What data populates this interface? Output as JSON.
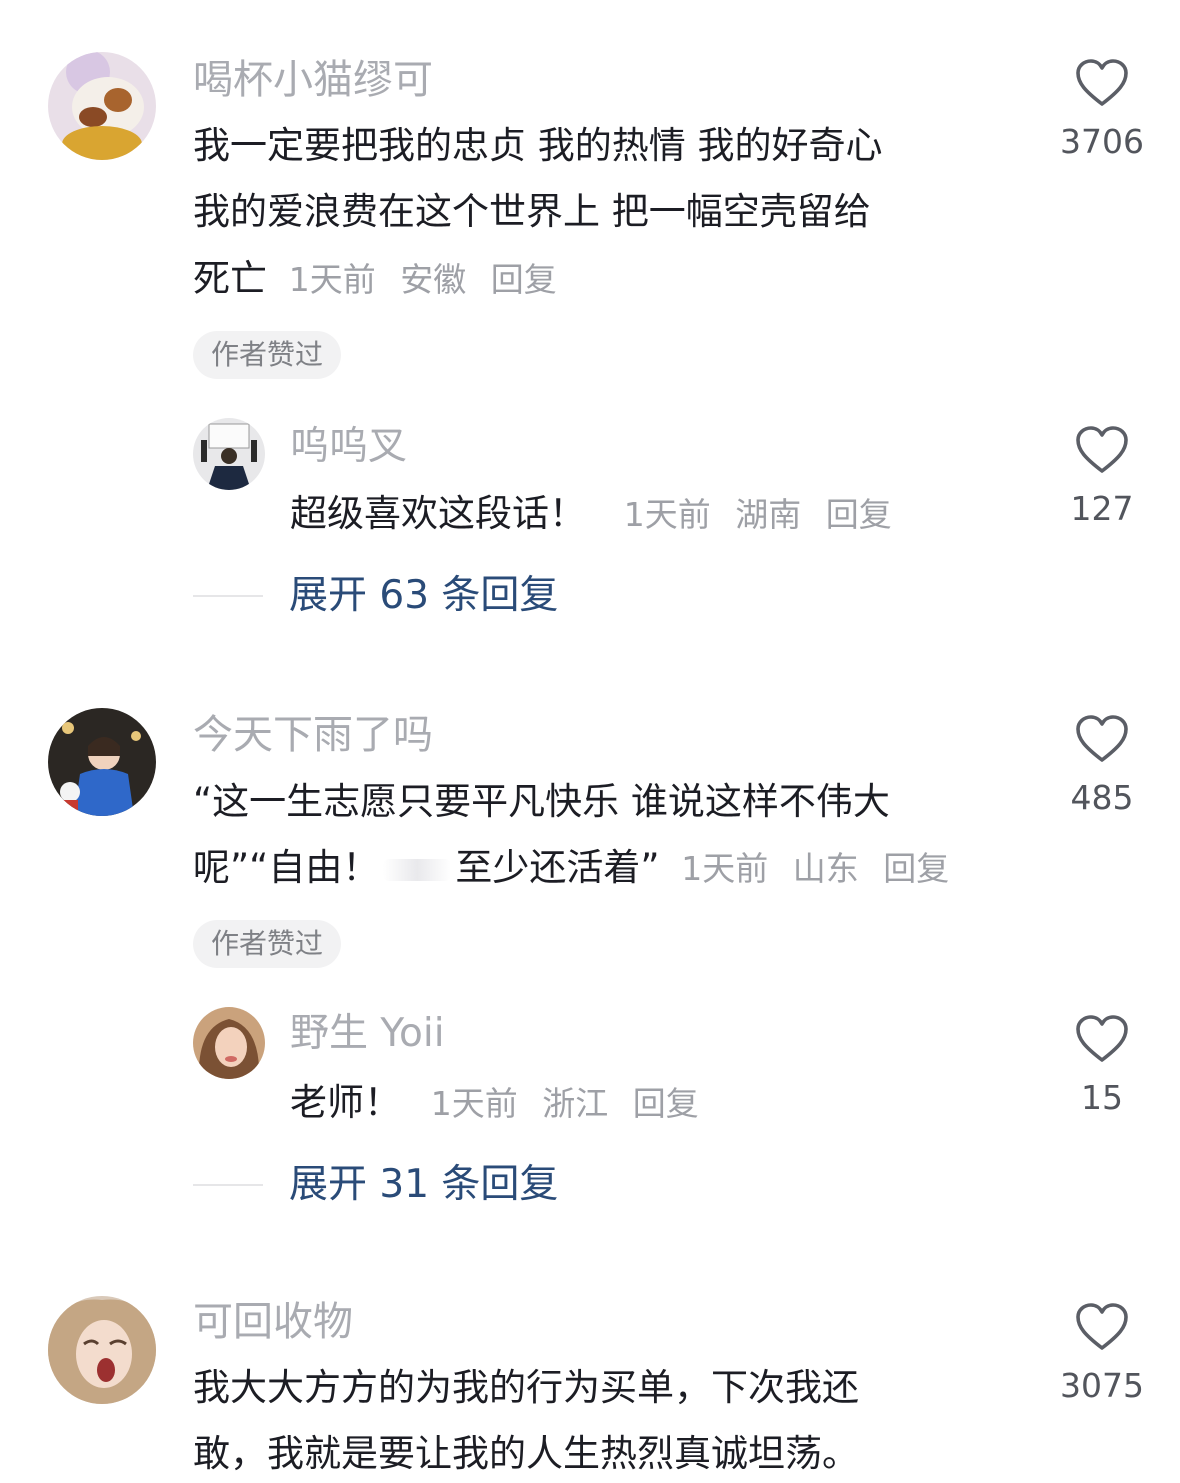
{
  "comments": [
    {
      "author": "喝杯小猫缪可",
      "text_lines": [
        "我一定要把我的忠贞 我的热情 我的好奇心",
        "我的爱浪费在这个世界上 把一幅空壳留给",
        "死亡"
      ],
      "time": "1天前",
      "location": "安徽",
      "reply": "回复",
      "badge": "作者赞过",
      "likes": "3706",
      "subreply": {
        "author": "呜呜叉",
        "text": "超级喜欢这段话！",
        "time": "1天前",
        "location": "湖南",
        "reply": "回复",
        "likes": "127"
      },
      "expand": "展开 63 条回复"
    },
    {
      "author": "今天下雨了吗",
      "text_lines": [
        "“这一生志愿只要平凡快乐 谁说这样不伟大",
        "呢”“自由！",
        "至少还活着”"
      ],
      "time": "1天前",
      "location": "山东",
      "reply": "回复",
      "badge": "作者赞过",
      "likes": "485",
      "subreply": {
        "author": "野生 Yoii",
        "text": "老师！",
        "time": "1天前",
        "location": "浙江",
        "reply": "回复",
        "likes": "15"
      },
      "expand": "展开 31 条回复"
    },
    {
      "author": "可回收物",
      "text_lines": [
        "我大大方方的为我的行为买单，下次我还",
        "敢，我就是要让我的人生热烈真诚坦荡。"
      ],
      "likes": "3075"
    }
  ],
  "icons": {
    "like": "heart-outline-icon"
  },
  "colors": {
    "name": "#a9abb1",
    "text": "#1c1d24",
    "meta": "#9ea0a6",
    "link": "#2a4b78",
    "badge_bg": "#f2f2f3"
  }
}
